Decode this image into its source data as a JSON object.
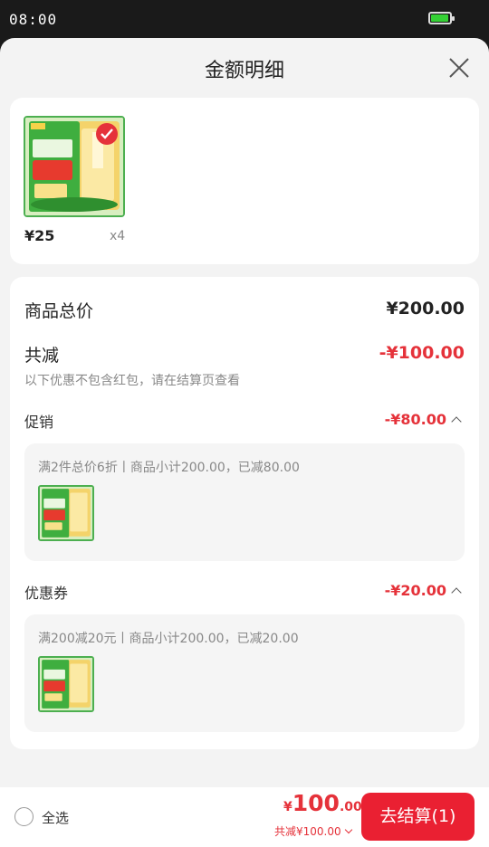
{
  "status": {
    "time": "08:00",
    "battery_color": "#35d035",
    "battery_level": 0.85
  },
  "sheet": {
    "title": "金额明细",
    "close_icon": "close-icon"
  },
  "product": {
    "price": "¥25",
    "qty": "x4",
    "image_texts": {
      "brand": "乳玉皇妃",
      "tag_top": "金龙鱼",
      "line1": "乳玉皇妃",
      "line2": "国韵当潮",
      "line3": "6步鲜米",
      "line4": "精控技术",
      "line5": "金牛奖",
      "line6": "奖项入围"
    }
  },
  "summary": {
    "total_label": "商品总价",
    "total_value": "¥200.00",
    "reduce_label": "共减",
    "reduce_value": "-¥100.00",
    "note": "以下优惠不包含红包，请在结算页查看"
  },
  "promotion": {
    "label": "促销",
    "value": "-¥80.00",
    "detail": "满2件总价6折丨商品小计200.00，已减80.00"
  },
  "coupon": {
    "label": "优惠券",
    "value": "-¥20.00",
    "detail": "满200减20元丨商品小计200.00，已减20.00"
  },
  "bottom": {
    "select_all": "全选",
    "currency": "¥",
    "total_int": "100",
    "total_dec": ".00",
    "reduce_text": "共减¥100.00",
    "checkout": "去结算(1)"
  },
  "colors": {
    "accent": "#e5323a",
    "button": "#ea2032",
    "product_green": "#4caf50"
  }
}
